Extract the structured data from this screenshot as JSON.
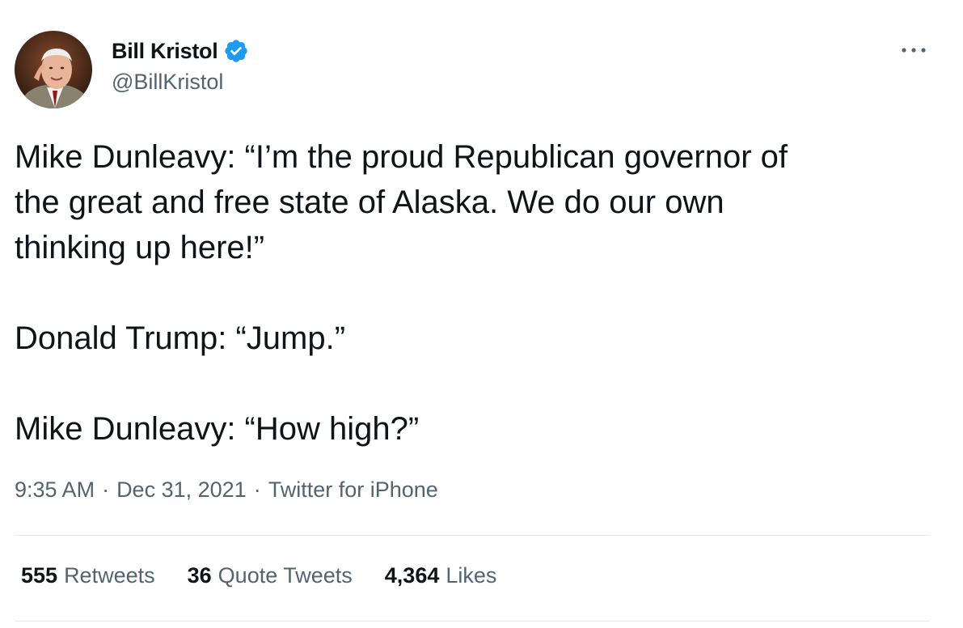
{
  "author": {
    "display_name": "Bill Kristol",
    "handle": "@BillKristol",
    "verified": true,
    "avatar_icon": "profile-photo",
    "verified_icon": "verified-badge-icon",
    "verified_color": "#1d9bf0"
  },
  "more_icon": "more-options-icon",
  "tweet": {
    "paragraphs": [
      "Mike Dunleavy: “I’m the proud Republican governor of\nthe great and free state of Alaska. We do our own\nthinking up here!”",
      "Donald Trump: “Jump.”",
      "Mike Dunleavy: “How high?”"
    ]
  },
  "meta": {
    "time": "9:35 AM",
    "separator": "·",
    "date": "Dec 31, 2021",
    "source": "Twitter for iPhone"
  },
  "stats": {
    "retweets_count": "555",
    "retweets_label": "Retweets",
    "quotes_count": "36",
    "quotes_label": "Quote Tweets",
    "likes_count": "4,364",
    "likes_label": "Likes"
  },
  "colors": {
    "text_primary": "#0f1419",
    "text_secondary": "#536471",
    "divider": "#e6e9eb",
    "accent": "#1d9bf0"
  }
}
